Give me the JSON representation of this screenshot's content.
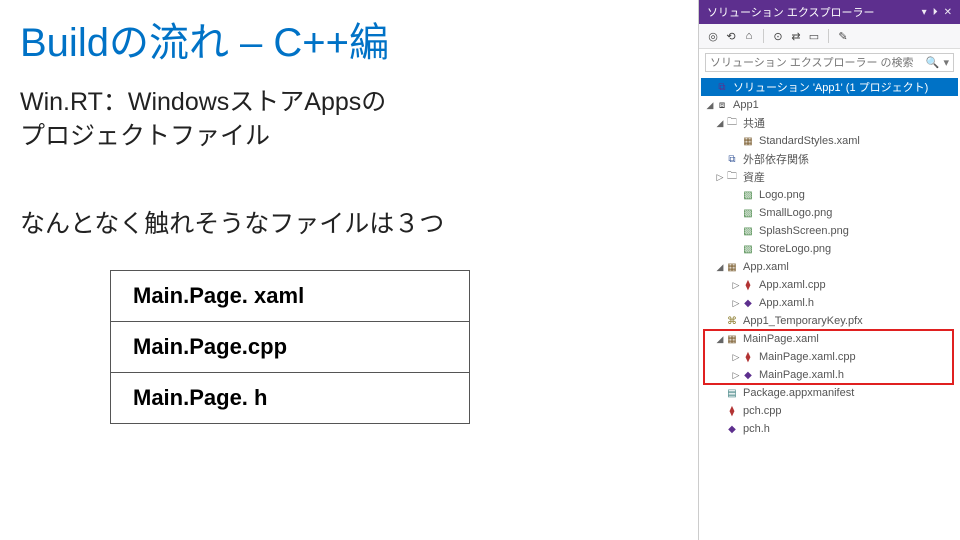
{
  "slide": {
    "title": "Buildの流れ – C++編",
    "subtitle_l1": "Win.RT：WindowsストアAppsの",
    "subtitle_l2": "プロジェクトファイル",
    "line2": "なんとなく触れそうなファイルは３つ",
    "files": [
      {
        "label": "Main.Page. xaml"
      },
      {
        "label": "Main.Page.cpp"
      },
      {
        "label": "Main.Page. h"
      }
    ]
  },
  "panel": {
    "title": "ソリューション エクスプローラー",
    "title_buttons": {
      "dropdown": "▾",
      "pin": "⏵",
      "close": "✕"
    },
    "toolbar_icons": [
      "◎",
      "⟲",
      "⌂",
      "",
      "⊙",
      "⇄",
      "▭",
      "",
      "✎"
    ],
    "search_placeholder": "ソリューション エクスプローラー の検索",
    "search_icon": "🔍",
    "search_dropdown": "▾"
  },
  "tree": [
    {
      "depth": 0,
      "expand": "",
      "icon": "⧉",
      "iconClass": "c-sln",
      "label": "ソリューション 'App1' (1 プロジェクト)",
      "selected": true
    },
    {
      "depth": 0,
      "expand": "◢",
      "icon": "⧈",
      "iconClass": "c-proj",
      "label": "App1"
    },
    {
      "depth": 1,
      "expand": "◢",
      "icon": "🗀",
      "iconClass": "c-folder",
      "label": "共通"
    },
    {
      "depth": 2,
      "expand": "",
      "icon": "▦",
      "iconClass": "c-xaml",
      "label": "StandardStyles.xaml"
    },
    {
      "depth": 1,
      "expand": "",
      "icon": "⧉",
      "iconClass": "c-ref",
      "label": "外部依存関係"
    },
    {
      "depth": 1,
      "expand": "▷",
      "icon": "🗀",
      "iconClass": "c-folder",
      "label": "資産"
    },
    {
      "depth": 2,
      "expand": "",
      "icon": "▧",
      "iconClass": "c-img",
      "label": "Logo.png"
    },
    {
      "depth": 2,
      "expand": "",
      "icon": "▧",
      "iconClass": "c-img",
      "label": "SmallLogo.png"
    },
    {
      "depth": 2,
      "expand": "",
      "icon": "▧",
      "iconClass": "c-img",
      "label": "SplashScreen.png"
    },
    {
      "depth": 2,
      "expand": "",
      "icon": "▧",
      "iconClass": "c-img",
      "label": "StoreLogo.png"
    },
    {
      "depth": 1,
      "expand": "◢",
      "icon": "▦",
      "iconClass": "c-xaml",
      "label": "App.xaml"
    },
    {
      "depth": 2,
      "expand": "▷",
      "icon": "⧫",
      "iconClass": "c-cpp",
      "label": "App.xaml.cpp"
    },
    {
      "depth": 2,
      "expand": "▷",
      "icon": "◆",
      "iconClass": "c-h",
      "label": "App.xaml.h"
    },
    {
      "depth": 1,
      "expand": "",
      "icon": "⌘",
      "iconClass": "c-key",
      "label": "App1_TemporaryKey.pfx"
    },
    {
      "depth": 1,
      "expand": "◢",
      "icon": "▦",
      "iconClass": "c-xaml",
      "label": "MainPage.xaml",
      "hl": "start"
    },
    {
      "depth": 2,
      "expand": "▷",
      "icon": "⧫",
      "iconClass": "c-cpp",
      "label": "MainPage.xaml.cpp"
    },
    {
      "depth": 2,
      "expand": "▷",
      "icon": "◆",
      "iconClass": "c-h",
      "label": "MainPage.xaml.h",
      "hl": "end"
    },
    {
      "depth": 1,
      "expand": "",
      "icon": "▤",
      "iconClass": "c-mf",
      "label": "Package.appxmanifest"
    },
    {
      "depth": 1,
      "expand": "",
      "icon": "⧫",
      "iconClass": "c-cpp",
      "label": "pch.cpp"
    },
    {
      "depth": 1,
      "expand": "",
      "icon": "◆",
      "iconClass": "c-h",
      "label": "pch.h"
    }
  ]
}
